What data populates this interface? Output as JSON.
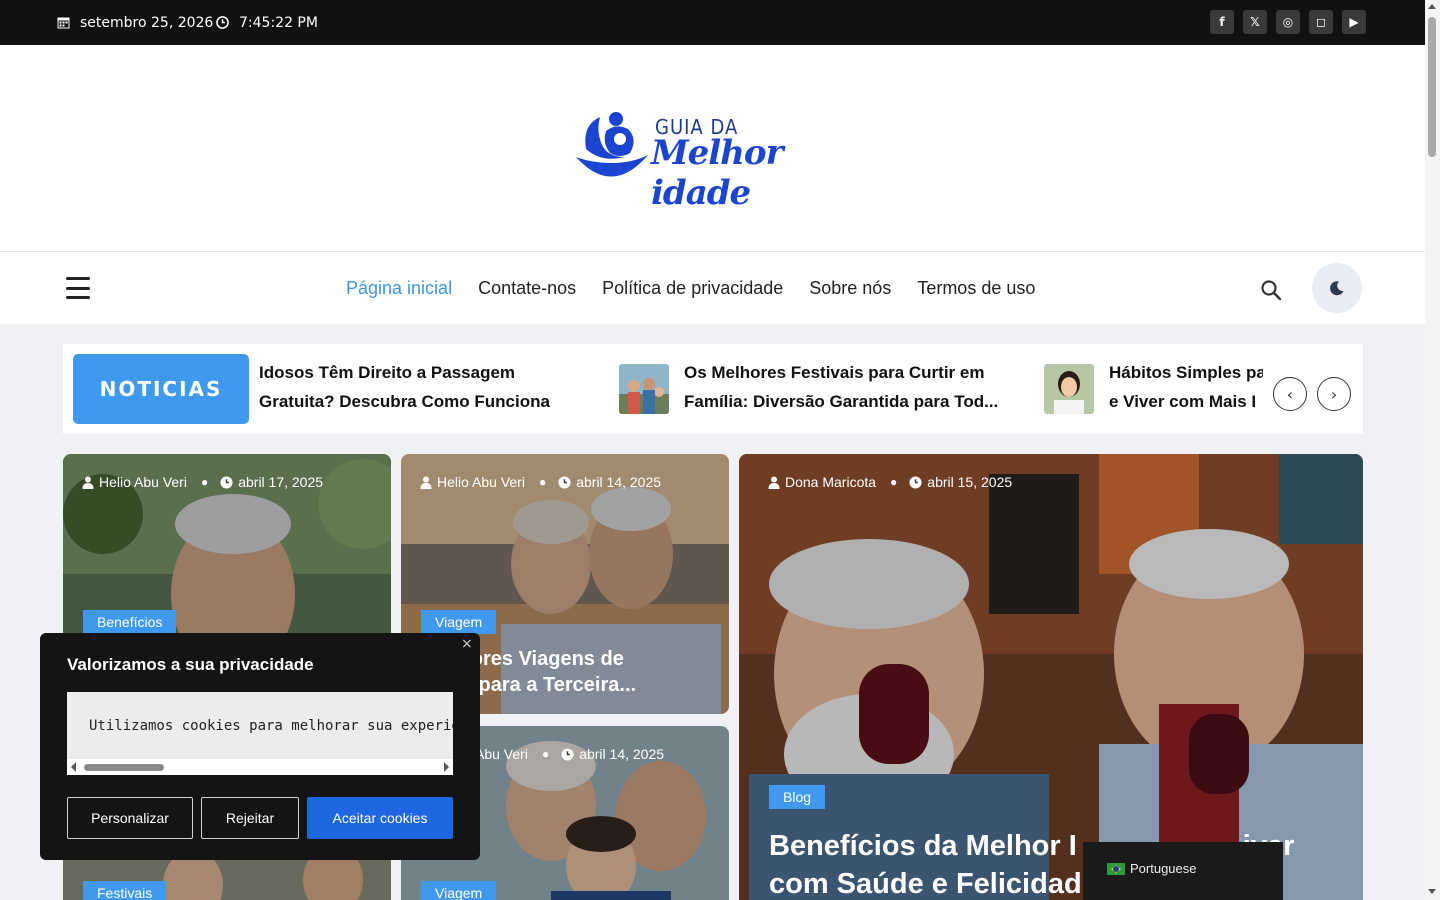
{
  "topbar": {
    "date": "setembro 25, 2026",
    "time": "7:45:22 PM",
    "social": [
      {
        "icon": "facebook-icon",
        "glyph": "f"
      },
      {
        "icon": "x-icon",
        "glyph": "𝕏"
      },
      {
        "icon": "dribbble-icon",
        "glyph": "◎"
      },
      {
        "icon": "instagram-icon",
        "glyph": "◻"
      },
      {
        "icon": "youtube-icon",
        "glyph": "▶"
      }
    ]
  },
  "logo": {
    "line1": "GUIA DA",
    "line2": "Melhor idade"
  },
  "nav": {
    "items": [
      "Página inicial",
      "Contate-nos",
      "Política de privacidade",
      "Sobre nós",
      "Termos de uso"
    ]
  },
  "ticker": {
    "label": "NOTICIAS",
    "items": [
      {
        "l1": "Idosos Têm Direito a Passagem",
        "l2": "Gratuita? Descubra Como Funciona"
      },
      {
        "l1": "Os Melhores Festivais para Curtir em",
        "l2": "Família: Diversão Garantida para Tod..."
      },
      {
        "l1": "Hábitos Simples pa",
        "l2": "e Viver com Mais I"
      }
    ]
  },
  "cards": [
    {
      "author": "Helio Abu Veri",
      "date": "abril 17, 2025",
      "category": "Benefícios",
      "title": ""
    },
    {
      "author": "Helio Abu Veri",
      "date": "abril 14, 2025",
      "category": "Viagem",
      "title_l1": "lhores Viagens de",
      "title_l2": "ro para a Terceira..."
    },
    {
      "author": "Abu Veri",
      "date": "abril 14, 2025",
      "category": "Viagem"
    },
    {
      "author": "Dona Maricota",
      "date": "abril 15, 2025",
      "category": "Blog",
      "title_l1": "Benefícios da Melhor I",
      "title_l1b": "iver",
      "title_l2": "com Saúde e Felicidad"
    },
    {
      "category": "Festivais"
    }
  ],
  "cookie": {
    "close": "×",
    "title": "Valorizamos a sua privacidade",
    "text": "Utilizamos cookies para melhorar sua experiência de navegação",
    "customize": "Personalizar",
    "reject": "Rejeitar",
    "accept": "Aceitar cookies"
  },
  "language": {
    "label": "Portuguese"
  },
  "colors": {
    "accent": "#3f9aef",
    "primary_button": "#1f67e0",
    "topbar": "#111111"
  }
}
